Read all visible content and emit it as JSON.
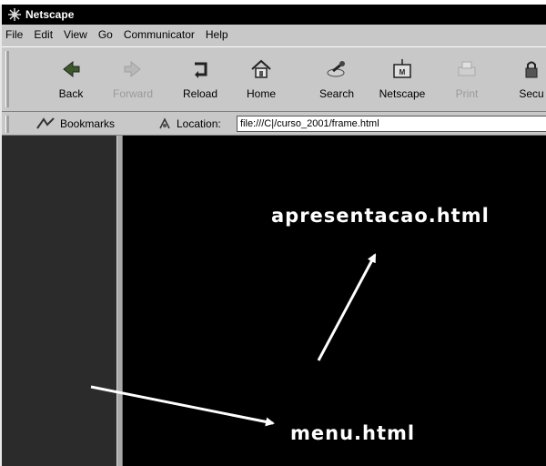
{
  "window": {
    "title": "Netscape"
  },
  "menu": [
    "File",
    "Edit",
    "View",
    "Go",
    "Communicator",
    "Help"
  ],
  "toolbar": [
    {
      "label": "Back",
      "icon": "back-arrow-icon",
      "enabled": true
    },
    {
      "label": "Forward",
      "icon": "forward-arrow-icon",
      "enabled": false
    },
    {
      "label": "Reload",
      "icon": "reload-icon",
      "enabled": true
    },
    {
      "label": "Home",
      "icon": "home-icon",
      "enabled": true
    },
    {
      "label": "Search",
      "icon": "search-icon",
      "enabled": true
    },
    {
      "label": "Netscape",
      "icon": "netscape-icon",
      "enabled": true
    },
    {
      "label": "Print",
      "icon": "print-icon",
      "enabled": false
    },
    {
      "label": "Secu",
      "icon": "security-lock-icon",
      "enabled": true
    }
  ],
  "location": {
    "bookmarks_label": "Bookmarks",
    "location_label": "Location:",
    "url": "file:///C|/curso_2001/frame.html"
  },
  "annotations": {
    "top_label": "apresentacao.html",
    "bottom_label": "menu.html"
  },
  "colors": {
    "content_bg": "#000000",
    "left_frame_bg": "#2b2b2b",
    "chrome": "#c8c8c8"
  }
}
